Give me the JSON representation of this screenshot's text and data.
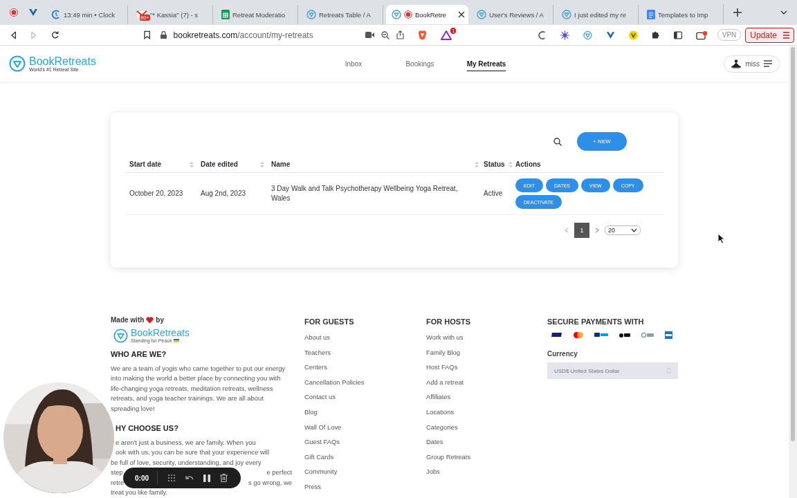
{
  "browser": {
    "pinned_tabs": [
      {
        "kind": "record"
      },
      {
        "kind": "vee"
      }
    ],
    "tabs": [
      {
        "title": "13:49 min • Clock",
        "kind": "clock",
        "selected": false
      },
      {
        "title": "\"* Kassia\" (7) - s",
        "kind": "gmail",
        "badge": "80+",
        "selected": false
      },
      {
        "title": "Retreat Moderatio",
        "kind": "sheets",
        "selected": false
      },
      {
        "title": "Retreats Table / A",
        "kind": "site",
        "selected": false
      },
      {
        "title": "BookRetre",
        "kind": "site",
        "recording": true,
        "selected": true
      },
      {
        "title": "User's Reviews / A",
        "kind": "site",
        "selected": false
      },
      {
        "title": "I just edited my re",
        "kind": "site",
        "selected": false
      },
      {
        "title": "Templates to Imp",
        "kind": "docs",
        "selected": false
      }
    ],
    "url_host": "bookretreats.com",
    "url_path": "/account/my-retreats",
    "rewards_badge": "1",
    "vpn": "VPN",
    "update": "Update"
  },
  "header": {
    "logo": "BookRetreats",
    "tagline": "World's #1 Retreat Site",
    "nav": [
      {
        "label": "Inbox",
        "selected": false
      },
      {
        "label": "Bookings",
        "selected": false
      },
      {
        "label": "My Retreats",
        "selected": true
      }
    ],
    "user": "miss"
  },
  "table": {
    "new_button": "+ NEW",
    "columns": [
      "Start date",
      "Date edited",
      "Name",
      "Status",
      "Actions"
    ],
    "rows": [
      {
        "start": "October 20, 2023",
        "edited": "Aug 2nd, 2023",
        "name": "3 Day Walk and Talk Psychotherapy Wellbeing Yoga Retreat, Wales",
        "status": "Active",
        "actions": [
          "EDIT",
          "DATES",
          "VIEW",
          "COPY",
          "DEACTIVATE"
        ]
      }
    ],
    "pagination": {
      "pages": [
        {
          "label": "1",
          "selected": true
        }
      ],
      "page_size": "20"
    }
  },
  "footer": {
    "made_with": "Made with",
    "by": "by",
    "logo": "BookRetreats",
    "logo_tagline": "Standing for Peace",
    "who_title": "WHO ARE WE?",
    "who_text": "We are a team of yogis who came together to put our energy into making the world a better place by connecting you with life-changing yoga retreats, meditation retreats, wellness retreats, and yoga teacher trainings. We are all about spreading love!",
    "why_title": "HY CHOOSE US?",
    "why_lines": [
      [
        "e aren't just a business, we are family. When you"
      ],
      [
        "ook with us, you can be sure that your experience will"
      ],
      [
        "be full of love, security, understanding, and joy every"
      ],
      [
        "step",
        "e perfect"
      ],
      [
        "retre",
        "s go wrong, we"
      ],
      [
        "treat you like family."
      ]
    ],
    "columns": [
      {
        "title": "FOR GUESTS",
        "links": [
          "About us",
          "Teachers",
          "Centers",
          "Cancellation Policies",
          "Contact us",
          "Blog",
          "Wall Of Love",
          "Guest FAQs",
          "Gift Cards",
          "Community",
          "Press"
        ]
      },
      {
        "title": "FOR HOSTS",
        "links": [
          "Work with us",
          "Family Blog",
          "Host FAQs",
          "Add a retreat",
          "Affiliates",
          "Locations",
          "Categories",
          "Dates",
          "Group Retreats",
          "Jobs"
        ]
      }
    ],
    "payments_title": "SECURE PAYMENTS WITH",
    "payments": [
      {
        "kind": "visa"
      },
      {
        "kind": "mastercard"
      },
      {
        "kind": "paypal"
      },
      {
        "kind": "applepay"
      },
      {
        "kind": "gpay"
      },
      {
        "kind": "amex"
      }
    ],
    "currency_label": "Currency",
    "currency_value": "USD$ United States Dollar"
  },
  "recorder": {
    "time": "0:00"
  }
}
